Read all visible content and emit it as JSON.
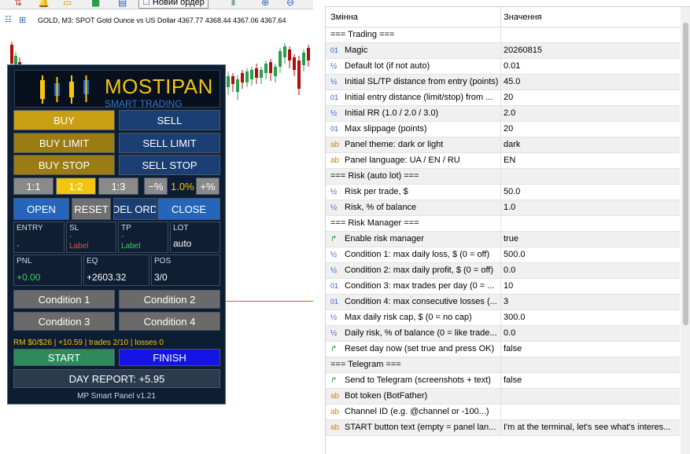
{
  "toolbar": {
    "new_order_label": "Новий ордер"
  },
  "chart": {
    "title": "GOLD, M3:  SPOT Gold Ounce vs US Dollar  4367.77 4368.44 4367.06 4367.64"
  },
  "panel": {
    "brand_title": "MOSTIPAN",
    "brand_sub": "SMART TRADING",
    "buy": "BUY",
    "sell": "SELL",
    "buy_limit": "BUY LIMIT",
    "sell_limit": "SELL LIMIT",
    "buy_stop": "BUY STOP",
    "sell_stop": "SELL STOP",
    "rr": [
      "1:1",
      "1:2",
      "1:3"
    ],
    "rr_active": "1:2",
    "risk_minus": "−%",
    "risk_value": "1.0%",
    "risk_plus": "+%",
    "open": "OPEN",
    "reset": "RESET",
    "del_orders": "DEL ORD",
    "close": "CLOSE",
    "entry": {
      "label": "ENTRY",
      "value": "-"
    },
    "sl": {
      "label": "SL",
      "value": "-",
      "sub": "Label"
    },
    "tp": {
      "label": "TP",
      "value": "-",
      "sub": "Label"
    },
    "lot": {
      "label": "LOT",
      "value": "auto"
    },
    "pnl": {
      "label": "PNL",
      "value": "+0.00"
    },
    "eq": {
      "label": "EQ",
      "value": "+2603.32"
    },
    "pos": {
      "label": "POS",
      "value": "3/0"
    },
    "conditions": [
      "Condition 1",
      "Condition 2",
      "Condition 3",
      "Condition 4"
    ],
    "rm_status": "RM $0/$26 | +10.59 | trades 2/10 | losses 0",
    "start": "START",
    "finish": "FINISH",
    "day_report": "DAY REPORT: +5.95",
    "version": "MP Smart Panel v1.21",
    "colors": {
      "buy": "#c9a014",
      "sell": "#1b3f73",
      "accent": "#f2c511",
      "start": "#2e8a5a",
      "finish": "#1414e4"
    }
  },
  "params": {
    "col_name": "Змінна",
    "col_value": "Значення",
    "rows": [
      {
        "icon": "",
        "name": "=== Trading ===",
        "value": ""
      },
      {
        "icon": "01",
        "name": "Magic",
        "value": "20260815"
      },
      {
        "icon": "½",
        "name": "Default lot (if not auto)",
        "value": "0.01"
      },
      {
        "icon": "½",
        "name": "Initial SL/TP distance from entry (points)",
        "value": "45.0"
      },
      {
        "icon": "01",
        "name": "Initial entry distance (limit/stop) from ...",
        "value": "20"
      },
      {
        "icon": "½",
        "name": "Initial RR (1.0 / 2.0 / 3.0)",
        "value": "2.0"
      },
      {
        "icon": "01",
        "name": "Max slippage (points)",
        "value": "20"
      },
      {
        "icon": "ab",
        "name": "Panel theme: dark or light",
        "value": "dark"
      },
      {
        "icon": "ab",
        "name": "Panel language: UA / EN / RU",
        "value": "EN"
      },
      {
        "icon": "",
        "name": "=== Risk (auto lot) ===",
        "value": ""
      },
      {
        "icon": "½",
        "name": "Risk per trade, $",
        "value": "50.0"
      },
      {
        "icon": "½",
        "name": "Risk, % of balance",
        "value": "1.0"
      },
      {
        "icon": "",
        "name": "=== Risk Manager ===",
        "value": ""
      },
      {
        "icon": "bool",
        "name": "Enable risk manager",
        "value": "true"
      },
      {
        "icon": "½",
        "name": "Condition 1: max daily loss, $ (0 = off)",
        "value": "500.0"
      },
      {
        "icon": "½",
        "name": "Condition 2: max daily profit, $ (0 = off)",
        "value": "0.0"
      },
      {
        "icon": "01",
        "name": "Condition 3: max trades per day (0 = ...",
        "value": "10"
      },
      {
        "icon": "01",
        "name": "Condition 4: max consecutive losses (...",
        "value": "3"
      },
      {
        "icon": "½",
        "name": "Max daily risk cap, $ (0 = no cap)",
        "value": "300.0"
      },
      {
        "icon": "½",
        "name": "Daily risk, % of balance (0 = like trade...",
        "value": "0.0"
      },
      {
        "icon": "bool",
        "name": "Reset day now (set true and press OK)",
        "value": "false"
      },
      {
        "icon": "",
        "name": "=== Telegram ===",
        "value": ""
      },
      {
        "icon": "bool",
        "name": "Send to Telegram (screenshots + text)",
        "value": "false"
      },
      {
        "icon": "ab",
        "name": "Bot token (BotFather)",
        "value": ""
      },
      {
        "icon": "ab",
        "name": "Channel ID (e.g. @channel or -100...)",
        "value": ""
      },
      {
        "icon": "ab",
        "name": "START button text (empty = panel lan...",
        "value": "I'm at the terminal, let's see what's interes..."
      }
    ]
  }
}
